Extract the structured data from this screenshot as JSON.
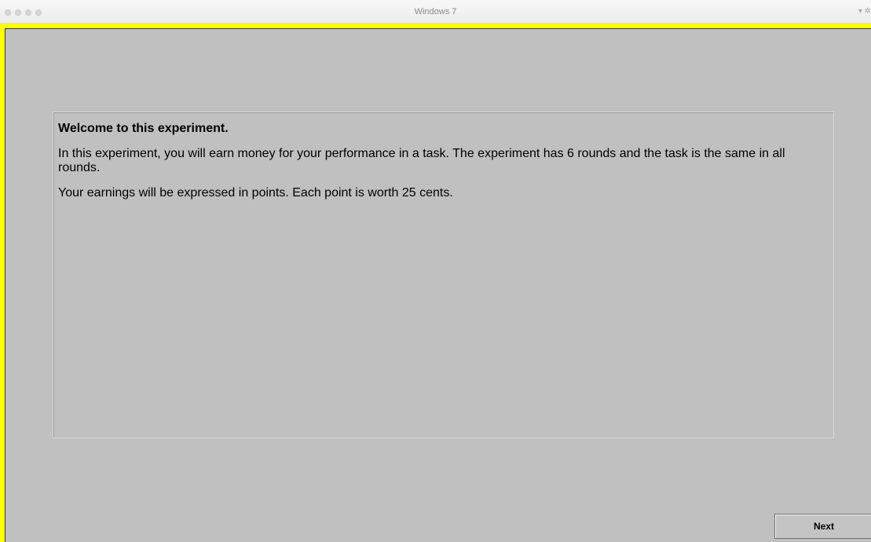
{
  "window": {
    "title": "Windows 7",
    "controls": "▾ ✲"
  },
  "content": {
    "welcome": "Welcome to this experiment.",
    "paragraphs": [
      "In this experiment, you will earn money for your performance in a task. The experiment has 6 rounds and the task is the same in all rounds.",
      "Your earnings will be expressed in points. Each point is worth 25 cents."
    ]
  },
  "buttons": {
    "next_label": "Next"
  },
  "colors": {
    "frame": "#ffff00",
    "background": "#c0c0c0"
  }
}
